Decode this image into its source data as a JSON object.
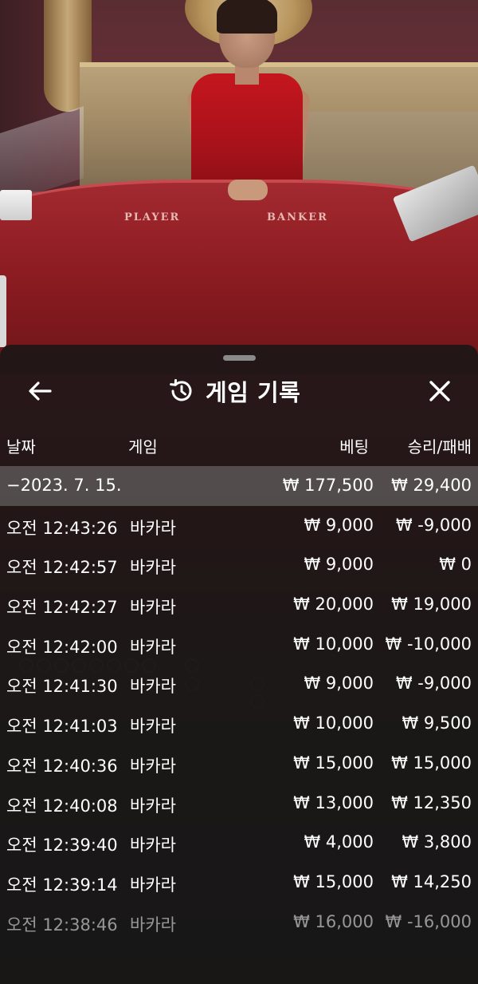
{
  "stream": {
    "table_labels": [
      "PLAYER",
      "BANKER"
    ]
  },
  "sheet": {
    "title": "게임 기록",
    "icons": {
      "back": "arrow-left-icon",
      "history": "history-icon",
      "close": "close-icon"
    },
    "columns": {
      "date": "날짜",
      "game": "게임",
      "bet": "베팅",
      "win_loss": "승리/패배"
    },
    "summary": {
      "date": "−2023. 7. 15.",
      "bet": "₩ 177,500",
      "win_loss": "₩ 29,400"
    },
    "rows": [
      {
        "time": "오전 12:43:26",
        "game": "바카라",
        "bet": "₩ 9,000",
        "win_loss": "₩ -9,000"
      },
      {
        "time": "오전 12:42:57",
        "game": "바카라",
        "bet": "₩ 9,000",
        "win_loss": "₩ 0"
      },
      {
        "time": "오전 12:42:27",
        "game": "바카라",
        "bet": "₩ 20,000",
        "win_loss": "₩ 19,000"
      },
      {
        "time": "오전 12:42:00",
        "game": "바카라",
        "bet": "₩ 10,000",
        "win_loss": "₩ -10,000"
      },
      {
        "time": "오전 12:41:30",
        "game": "바카라",
        "bet": "₩ 9,000",
        "win_loss": "₩ -9,000"
      },
      {
        "time": "오전 12:41:03",
        "game": "바카라",
        "bet": "₩ 10,000",
        "win_loss": "₩ 9,500"
      },
      {
        "time": "오전 12:40:36",
        "game": "바카라",
        "bet": "₩ 15,000",
        "win_loss": "₩ 15,000"
      },
      {
        "time": "오전 12:40:08",
        "game": "바카라",
        "bet": "₩ 13,000",
        "win_loss": "₩ 12,350"
      },
      {
        "time": "오전 12:39:40",
        "game": "바카라",
        "bet": "₩ 4,000",
        "win_loss": "₩ 3,800"
      },
      {
        "time": "오전 12:39:14",
        "game": "바카라",
        "bet": "₩ 15,000",
        "win_loss": "₩ 14,250"
      },
      {
        "time": "오전 12:38:46",
        "game": "바카라",
        "bet": "₩ 16,000",
        "win_loss": "₩ -16,000"
      }
    ]
  }
}
